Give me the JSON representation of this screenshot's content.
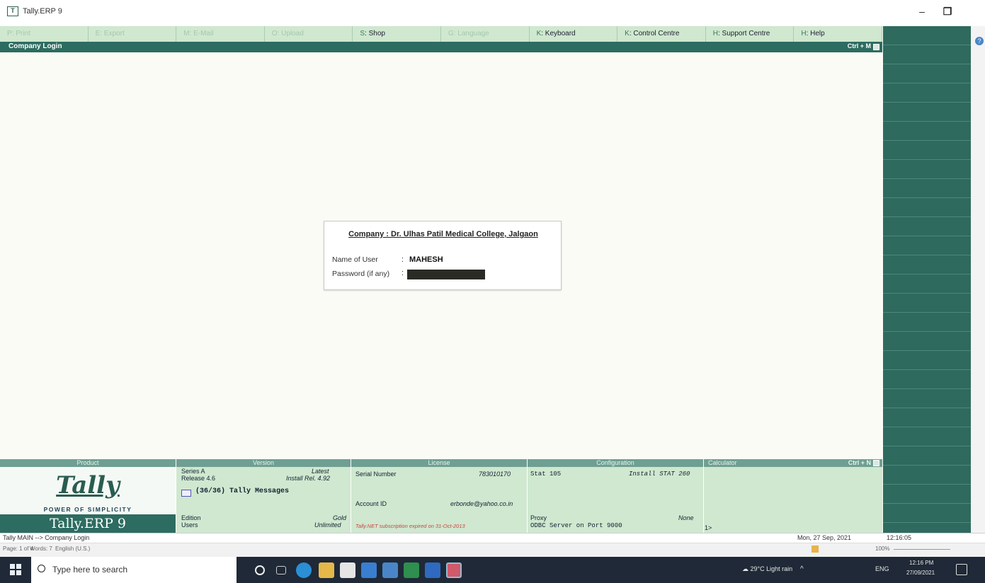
{
  "window": {
    "title": "Tally.ERP 9",
    "minimize": "–",
    "maximize": "❐"
  },
  "topbar": {
    "buttons": [
      {
        "key": "P",
        "label": ": Print",
        "enabled": false
      },
      {
        "key": "E",
        "label": ": Export",
        "enabled": false
      },
      {
        "key": "M",
        "label": ": E-Mail",
        "enabled": false
      },
      {
        "key": "O",
        "label": ": Upload",
        "enabled": false
      },
      {
        "key": "S",
        "label": ": Shop",
        "enabled": true
      },
      {
        "key": "G",
        "label": ": Language",
        "enabled": false
      },
      {
        "key": "K",
        "label": ": Keyboard",
        "enabled": true
      },
      {
        "key": "K",
        "label": ": Control Centre",
        "enabled": true
      },
      {
        "key": "H",
        "label": ": Support Centre",
        "enabled": true
      },
      {
        "key": "H",
        "label": ": Help",
        "enabled": true
      }
    ]
  },
  "header": {
    "title": "Company Login",
    "shortcut": "Ctrl + M"
  },
  "login": {
    "company": "Company : Dr. Ulhas Patil Medical College, Jalgaon",
    "user_label": "Name of User",
    "user_value": "MAHESH",
    "password_label": "Password (if any)",
    "colon": ":"
  },
  "info": {
    "product": {
      "header": "Product",
      "logo": "Tally",
      "tagline": "POWER OF SIMPLICITY",
      "name": "Tally.ERP 9"
    },
    "version": {
      "header": "Version",
      "series": "Series A",
      "latest": "Latest",
      "release": "Release 4.6",
      "install_rel": "Install Rel. 4.92",
      "messages": "(36/36) Tally Messages",
      "edition_label": "Edition",
      "edition_value": "Gold",
      "users_label": "Users",
      "users_value": "Unlimited"
    },
    "license": {
      "header": "License",
      "serial_label": "Serial Number",
      "serial_value": "783010170",
      "account_label": "Account ID",
      "account_value": "erbonde@yahoo.co.in",
      "warning": "Tally.NET subscription expired on 31-Oct-2013"
    },
    "configuration": {
      "header": "Configuration",
      "stat": "Stat 105",
      "install_stat": "Install STAT 260",
      "proxy_label": "Proxy",
      "proxy_value": "None",
      "odbc": "ODBC Server on Port 9000"
    },
    "calculator": {
      "header": "Calculator",
      "shortcut": "Ctrl + N",
      "prompt": "1>"
    }
  },
  "status": {
    "path": "Tally MAIN --> Company Login",
    "date": "Mon, 27 Sep, 2021",
    "time": "12:16:05",
    "word_page": "Page: 1 of 4",
    "word_words": "Words: 7",
    "word_lang": "English (U.S.)",
    "zoom": "100%"
  },
  "taskbar": {
    "search_placeholder": "Type here to search",
    "weather": "29°C Light rain",
    "lang": "ENG",
    "clock_time": "12:16 PM",
    "clock_date": "27/09/2021"
  }
}
